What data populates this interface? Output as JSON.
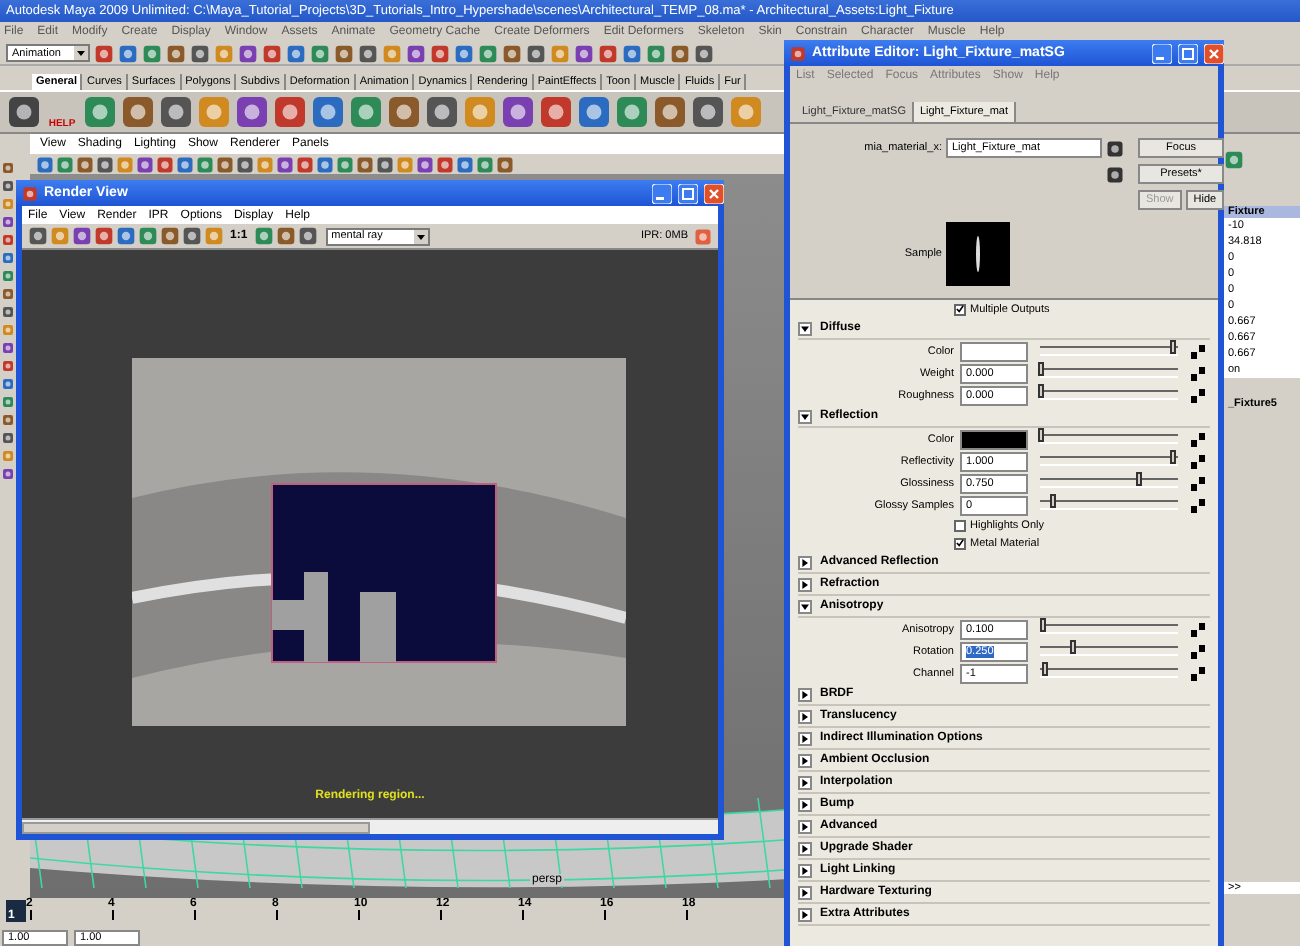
{
  "window": {
    "title": "Autodesk Maya 2009 Unlimited: C:\\Maya_Tutorial_Projects\\3D_Tutorials_Intro_Hypershade\\scenes\\Architectural_TEMP_08.ma* - Architectural_Assets:Light_Fixture"
  },
  "menu_bar": [
    "File",
    "Edit",
    "Modify",
    "Create",
    "Display",
    "Window",
    "Assets",
    "Animate",
    "Geometry Cache",
    "Create Deformers",
    "Edit Deformers",
    "Skeleton",
    "Skin",
    "Constrain",
    "Character",
    "Muscle",
    "Help"
  ],
  "status_line": {
    "mode": "Animation"
  },
  "shelf_tabs": [
    {
      "label": "General",
      "selected": true
    },
    {
      "label": "Curves",
      "selected": false
    },
    {
      "label": "Surfaces",
      "selected": false
    },
    {
      "label": "Polygons",
      "selected": false
    },
    {
      "label": "Subdivs",
      "selected": false
    },
    {
      "label": "Deformation",
      "selected": false
    },
    {
      "label": "Animation",
      "selected": false
    },
    {
      "label": "Dynamics",
      "selected": false
    },
    {
      "label": "Rendering",
      "selected": false
    },
    {
      "label": "PaintEffects",
      "selected": false
    },
    {
      "label": "Toon",
      "selected": false
    },
    {
      "label": "Muscle",
      "selected": false
    },
    {
      "label": "Fluids",
      "selected": false
    },
    {
      "label": "Fur",
      "selected": false
    }
  ],
  "shelf": {
    "help_label": "HELP"
  },
  "viewport": {
    "menu": [
      "View",
      "Shading",
      "Lighting",
      "Show",
      "Renderer",
      "Panels"
    ],
    "camera": "persp"
  },
  "channel_box": {
    "header": "Fixture",
    "values": [
      "-10",
      "34.818",
      "0",
      "0",
      "0",
      "0",
      "0.667",
      "0.667",
      "0.667",
      "on"
    ],
    "footer": "_Fixture5",
    "more": ">>"
  },
  "time_slider": {
    "current": "1",
    "ticks": [
      "2",
      "4",
      "6",
      "8",
      "10",
      "12",
      "14",
      "16",
      "18"
    ]
  },
  "range_slider": {
    "start": "1.00",
    "end": "1.00"
  },
  "render_view": {
    "title": "Render View",
    "menu": [
      "File",
      "View",
      "Render",
      "IPR",
      "Options",
      "Display",
      "Help"
    ],
    "zoom": "1:1",
    "renderer": "mental ray",
    "ipr": "IPR: 0MB",
    "status": "Rendering region..."
  },
  "attribute_editor": {
    "title": "Attribute Editor: Light_Fixture_matSG",
    "menu": [
      "List",
      "Selected",
      "Focus",
      "Attributes",
      "Show",
      "Help"
    ],
    "tabs": [
      {
        "label": "Light_Fixture_matSG",
        "selected": false
      },
      {
        "label": "Light_Fixture_mat",
        "selected": true
      }
    ],
    "node_type": "mia_material_x:",
    "node_name": "Light_Fixture_mat",
    "buttons": [
      {
        "label": "Focus",
        "disabled": false
      },
      {
        "label": "Presets*",
        "disabled": false
      },
      {
        "label": "Show",
        "disabled": true
      },
      {
        "label": "Hide",
        "disabled": false
      }
    ],
    "sample_label": "Sample",
    "multiple_outputs": {
      "label": "Multiple Outputs",
      "checked": true
    },
    "sections": [
      {
        "title": "Diffuse",
        "expanded": true,
        "rows": [
          {
            "kind": "color",
            "label": "Color",
            "color": "#ffffff",
            "level": 0.97
          },
          {
            "kind": "number",
            "label": "Weight",
            "value": "0.000",
            "level": 0.02,
            "highlighted": false
          },
          {
            "kind": "number",
            "label": "Roughness",
            "value": "0.000",
            "level": 0.02,
            "highlighted": false
          }
        ]
      },
      {
        "title": "Reflection",
        "expanded": true,
        "rows": [
          {
            "kind": "color",
            "label": "Color",
            "color": "#000000",
            "level": 0.02
          },
          {
            "kind": "number",
            "label": "Reflectivity",
            "value": "1.000",
            "level": 0.97,
            "highlighted": false
          },
          {
            "kind": "number",
            "label": "Glossiness",
            "value": "0.750",
            "level": 0.72,
            "highlighted": false
          },
          {
            "kind": "number",
            "label": "Glossy Samples",
            "value": "0",
            "level": 0.1,
            "highlighted": false
          },
          {
            "kind": "checkbox",
            "label": "Highlights Only",
            "checked": false
          },
          {
            "kind": "checkbox",
            "label": "Metal Material",
            "checked": true
          }
        ]
      },
      {
        "title": "Advanced Reflection",
        "expanded": false
      },
      {
        "title": "Refraction",
        "expanded": false
      },
      {
        "title": "Anisotropy",
        "expanded": true,
        "rows": [
          {
            "kind": "number",
            "label": "Anisotropy",
            "value": "0.100",
            "level": 0.03,
            "highlighted": false
          },
          {
            "kind": "number",
            "label": "Rotation",
            "value": "0.250",
            "level": 0.25,
            "highlighted": true
          },
          {
            "kind": "number",
            "label": "Channel",
            "value": "-1",
            "level": 0.05,
            "highlighted": false
          }
        ]
      },
      {
        "title": "BRDF",
        "expanded": false
      },
      {
        "title": "Translucency",
        "expanded": false
      },
      {
        "title": "Indirect Illumination Options",
        "expanded": false
      },
      {
        "title": "Ambient Occlusion",
        "expanded": false
      },
      {
        "title": "Interpolation",
        "expanded": false
      },
      {
        "title": "Bump",
        "expanded": false
      },
      {
        "title": "Advanced",
        "expanded": false
      },
      {
        "title": "Upgrade Shader",
        "expanded": false
      },
      {
        "title": "Light Linking",
        "expanded": false
      },
      {
        "title": "Hardware Texturing",
        "expanded": false
      },
      {
        "title": "Extra Attributes",
        "expanded": false
      }
    ]
  }
}
